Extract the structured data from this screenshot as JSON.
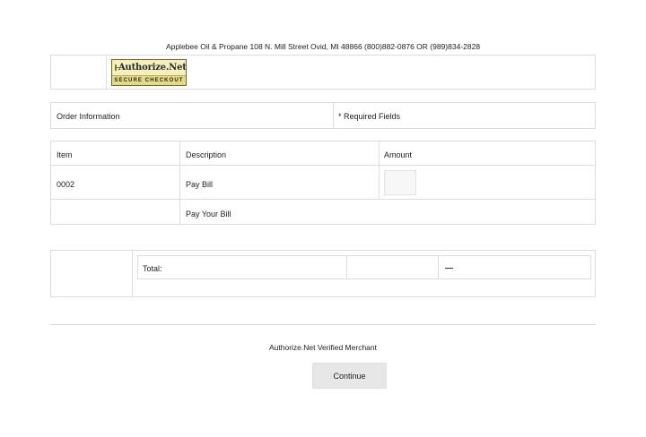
{
  "merchant_header": "Applebee Oil & Propane 108 N. Mill Street Ovid, MI 48866 (800)882-0876 OR (989)834-2828",
  "badge": {
    "brand": "Authorize.Net",
    "subtitle": "SECURE CHECKOUT"
  },
  "order_section": {
    "title": "Order Information",
    "required_note": "* Required Fields"
  },
  "items_table": {
    "headers": [
      "Item",
      "Description",
      "Amount"
    ],
    "rows": [
      {
        "item": "0002",
        "description": "Pay Bill",
        "amount": ""
      },
      {
        "item": "",
        "description": "Pay Your Bill",
        "amount": ""
      }
    ]
  },
  "totals": {
    "label": "Total:",
    "value": "—"
  },
  "footer": {
    "verified_text": "Authorize.Net Verified Merchant",
    "continue_label": "Continue"
  }
}
